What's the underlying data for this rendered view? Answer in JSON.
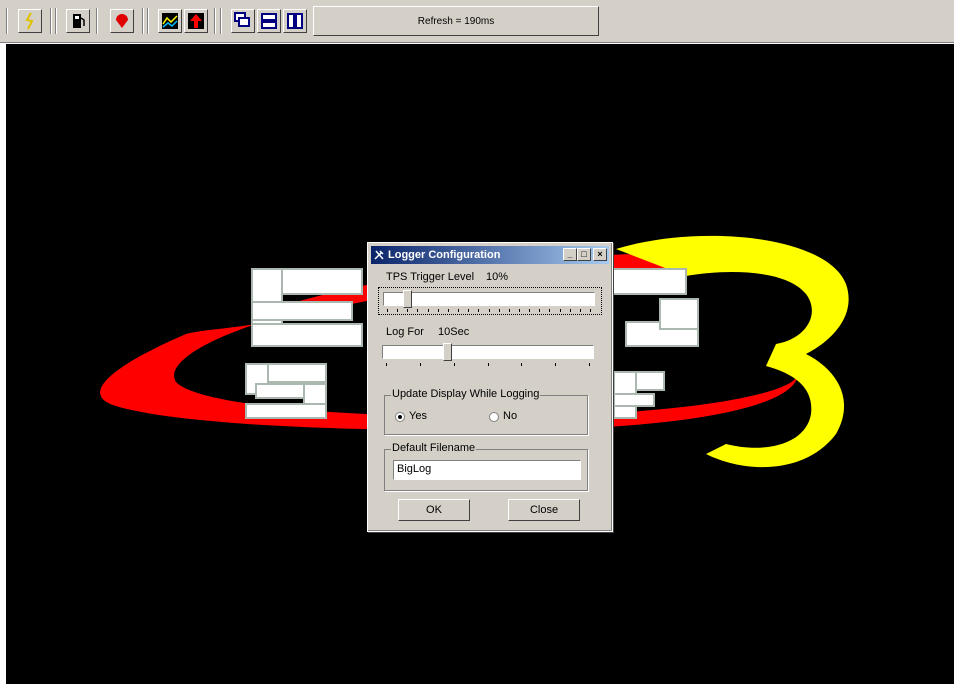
{
  "toolbar": {
    "buttons": [
      {
        "icon": "lightning-bolt-icon"
      },
      {
        "icon": "fuel-pump-icon"
      },
      {
        "icon": "red-marker-icon"
      },
      {
        "icon": "line-graph-icon"
      },
      {
        "icon": "red-arrow-up-icon"
      },
      {
        "icon": "cascade-windows-icon"
      },
      {
        "icon": "tile-horizontal-icon"
      },
      {
        "icon": "tile-vertical-icon"
      }
    ],
    "refresh_text": "Refresh = 190ms"
  },
  "logo": {
    "alt": "ESG STUFF 3",
    "colors": {
      "ring_red": "#ff0000",
      "ring_yellow": "#ffff00",
      "letters": "#ffffff"
    }
  },
  "dialog": {
    "title": "Logger Configuration",
    "title_icon": "wrench-icon",
    "minimize": "_",
    "maximize": "□",
    "close": "×",
    "tps": {
      "label": "TPS Trigger Level",
      "value_text": "10%",
      "value": 0.1
    },
    "log_for": {
      "label": "Log For",
      "value_text": "10Sec",
      "value": 0.3
    },
    "update_group": {
      "title": "Update Display While Logging",
      "options": [
        {
          "label": "Yes",
          "selected": true
        },
        {
          "label": "No",
          "selected": false
        }
      ]
    },
    "filename_group": {
      "title": "Default Filename",
      "value": "BigLog"
    },
    "ok_label": "OK",
    "close_label": "Close"
  }
}
